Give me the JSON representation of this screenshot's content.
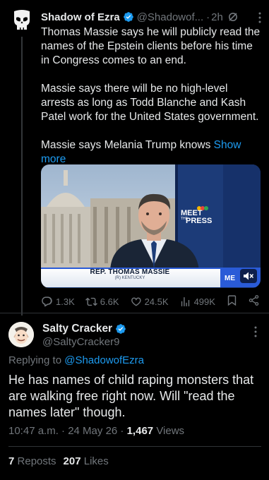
{
  "parent_post": {
    "author_name": "Shadow of Ezra",
    "author_handle": "@Shadowof...",
    "separator": "·",
    "time": "2h",
    "paragraphs": [
      "Thomas Massie says he will publicly read the names of the Epstein clients before his time in Congress comes to an end.",
      "Massie says there will be no high-level arrests as long as Todd Blanche and Kash Patel work for the United States government.",
      "Massie says Melania Trump knows"
    ],
    "show_more_label": "Show more",
    "media": {
      "chyron_name": "REP. THOMAS MASSIE",
      "chyron_sub": "(R) KENTUCKY",
      "watermark_line1": "MEET",
      "watermark_line2": "THE",
      "watermark_line3": "PRESS",
      "corner_mark": "ME"
    },
    "actions": {
      "replies": "1.3K",
      "reposts": "6.6K",
      "likes": "24.5K",
      "views": "499K"
    }
  },
  "reply": {
    "author_name": "Salty Cracker",
    "author_handle": "@SaltyCracker9",
    "replying_prefix": "Replying to",
    "replying_mention": "@ShadowofEzra",
    "text": "He has names of child raping monsters that are walking free right now. Will \"read the names later\" though.",
    "timestamp": "10:47 a.m. · 24 May 26 ·",
    "views_count": "1,467",
    "views_label": "Views",
    "reposts_count": "7",
    "reposts_label": "Reposts",
    "likes_count": "207",
    "likes_label": "Likes"
  },
  "colors": {
    "background": "#000000",
    "text_primary": "#e7e9ea",
    "text_secondary": "#71767b",
    "accent": "#1d9bf0",
    "divider": "#2f3336"
  }
}
